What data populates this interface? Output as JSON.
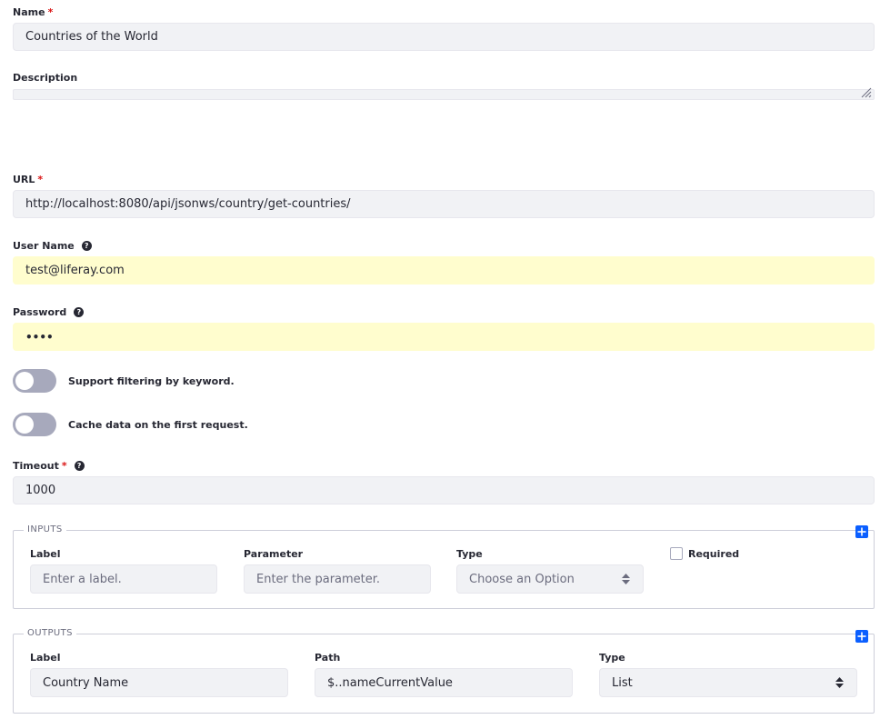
{
  "form": {
    "name": {
      "label": "Name",
      "required_mark": "*",
      "value": "Countries of the World"
    },
    "description": {
      "label": "Description",
      "value": ""
    },
    "url": {
      "label": "URL",
      "required_mark": "*",
      "value": "http://localhost:8080/api/jsonws/country/get-countries/"
    },
    "user_name": {
      "label": "User Name",
      "value": "test@liferay.com",
      "help_icon": "question-circle-icon"
    },
    "password": {
      "label": "Password",
      "value": "••••",
      "help_icon": "question-circle-icon"
    },
    "toggles": [
      {
        "label": "Support filtering by keyword.",
        "on": false
      },
      {
        "label": "Cache data on the first request.",
        "on": false
      }
    ],
    "timeout": {
      "label": "Timeout",
      "required_mark": "*",
      "value": "1000",
      "help_icon": "question-circle-icon"
    }
  },
  "inputs": {
    "legend": "INPUTS",
    "label": {
      "label": "Label",
      "placeholder": "Enter a label."
    },
    "parameter": {
      "label": "Parameter",
      "placeholder": "Enter the parameter."
    },
    "type": {
      "label": "Type",
      "value": "Choose an Option"
    },
    "required": {
      "label": "Required",
      "checked": false
    },
    "add_icon": "plus-icon"
  },
  "outputs": {
    "legend": "OUTPUTS",
    "label": {
      "label": "Label",
      "value": "Country Name"
    },
    "path": {
      "label": "Path",
      "value": "$..nameCurrentValue"
    },
    "type": {
      "label": "Type",
      "value": "List"
    },
    "add_icon": "plus-icon"
  },
  "colors": {
    "field_bg": "#f1f2f5",
    "autofill_bg": "#fffdce",
    "primary": "#0b5fff",
    "required": "#da1414",
    "toggle_off": "#a7a9bc"
  }
}
